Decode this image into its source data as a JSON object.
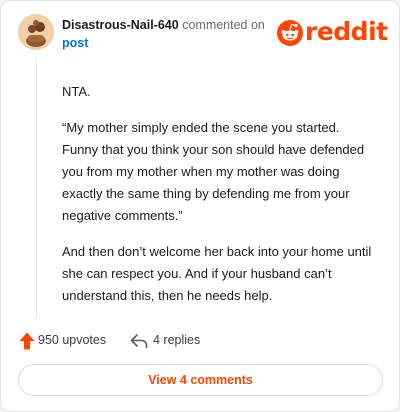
{
  "comment": {
    "username": "Disastrous-Nail-640",
    "action_text": "commented on",
    "post_link": "post",
    "body": [
      "NTA.",
      "“My mother simply ended the scene you started. Funny that you think your son should have defended you from my mother when my mother was doing exactly the same thing by defending me from your negative comments.”",
      "And then don’t welcome her back into your home until she can respect you. And if your husband can’t understand this, then he needs help."
    ]
  },
  "brand": {
    "logo_text": "reddit",
    "color": "#ff4500"
  },
  "actions": {
    "upvotes_label": "950 upvotes",
    "replies_label": "4 replies"
  },
  "footer": {
    "view_comments_label": "View 4 comments"
  },
  "colors": {
    "link": "#0079d3",
    "accent": "#ff4500",
    "text": "#1c1c1c"
  },
  "icons": [
    "avatar-icon",
    "reddit-logo-icon",
    "upvote-arrow-icon",
    "reply-arrow-icon"
  ]
}
